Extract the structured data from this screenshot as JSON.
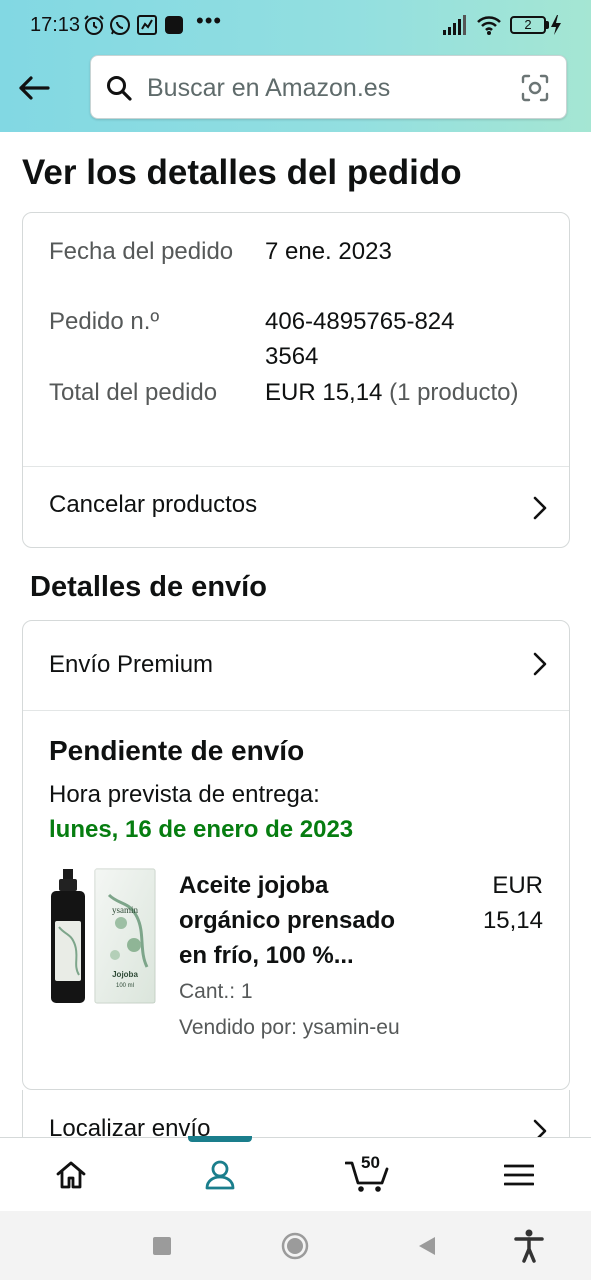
{
  "status_bar": {
    "time": "17:13",
    "battery": "2"
  },
  "search": {
    "placeholder": "Buscar en Amazon.es"
  },
  "page": {
    "title": "Ver los detalles del pedido"
  },
  "order_summary": {
    "date_label": "Fecha del pedido",
    "date_value": "7 ene. 2023",
    "number_label": "Pedido n.º",
    "number_value": "406-4895765-8243564",
    "total_label": "Total del pedido",
    "total_value": "EUR 15,14",
    "total_items": "(1 producto)",
    "cancel_link": "Cancelar productos"
  },
  "shipping": {
    "section_title": "Detalles de envío",
    "method": "Envío Premium",
    "status": "Pendiente de envío",
    "eta_label": "Hora prevista de entrega:",
    "eta_date": "lunes, 16 de enero de 2023",
    "track_link": "Localizar envío"
  },
  "product": {
    "title": "Aceite jojoba orgánico prensado en frío, 100 %...",
    "price_currency": "EUR",
    "price_value": "15,14",
    "quantity": "Cant.: 1",
    "seller": "Vendido por: ysamin-eu",
    "image_brand": "ysamin",
    "image_label": "Jojoba",
    "image_volume": "100 ml"
  },
  "bottom_nav": {
    "items": [
      "home-icon",
      "account-icon",
      "cart-icon",
      "menu-icon"
    ],
    "cart_count": "50",
    "active": "account",
    "accent_color": "#1a7e8c"
  },
  "colors": {
    "header_gradient_start": "#82d8e3",
    "header_gradient_end": "#a5e6d3",
    "delivery_green": "#067d10"
  }
}
